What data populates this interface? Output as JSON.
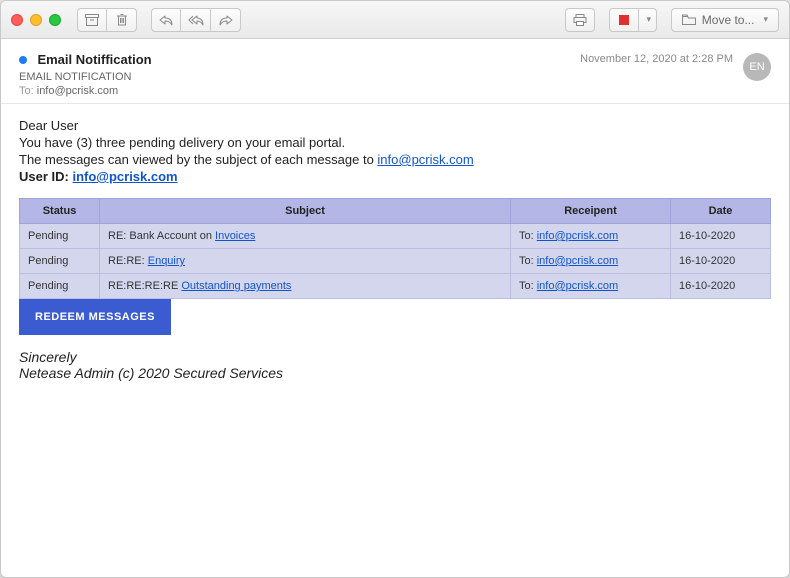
{
  "toolbar": {
    "move_label": "Move to..."
  },
  "header": {
    "subject": "Email Notiffication",
    "from": "EMAIL NOTIFICATION",
    "to_label": "To:",
    "to_value": "info@pcrisk.com",
    "date": "November 12, 2020 at 2:28 PM",
    "avatar": "EN"
  },
  "body": {
    "greeting": "Dear User",
    "line1": "You have (3) three pending delivery on your email portal.",
    "line2_pre": "The messages can viewed by the subject of each message to ",
    "line2_link": "info@pcrisk.com",
    "userid_label": "User ID: ",
    "userid_value": "info@pcrisk.com",
    "redeem": "REDEEM MESSAGES",
    "sig1": "Sincerely",
    "sig2": "Netease Admin (c) 2020 Secured Services"
  },
  "table": {
    "headers": {
      "status": "Status",
      "subject": "Subject",
      "recipient": "Receipent",
      "date": "Date"
    },
    "rows": [
      {
        "status": "Pending",
        "subj_pre": "RE: Bank Account on ",
        "subj_link": "Invoices",
        "to_pre": "To: ",
        "to_link": "info@pcrisk.com",
        "date": "16-10-2020"
      },
      {
        "status": "Pending",
        "subj_pre": "RE:RE: ",
        "subj_link": "Enquiry",
        "to_pre": "To: ",
        "to_link": "info@pcrisk.com",
        "date": "16-10-2020"
      },
      {
        "status": "Pending",
        "subj_pre": "RE:RE:RE:RE ",
        "subj_link": "Outstanding payments",
        "to_pre": "To: ",
        "to_link": "info@pcrisk.com",
        "date": "16-10-2020"
      }
    ]
  }
}
